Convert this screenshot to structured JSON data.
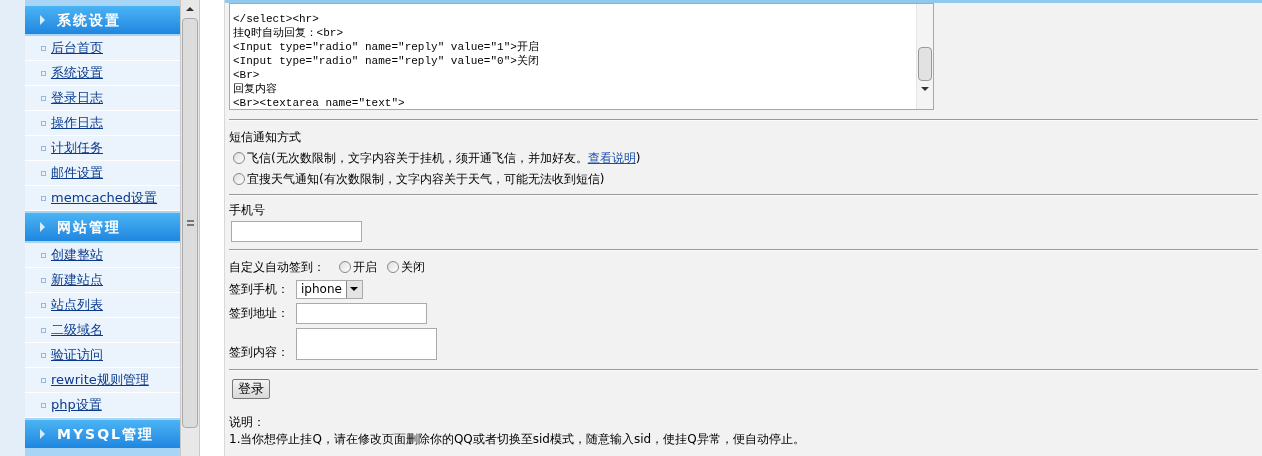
{
  "sidebar": {
    "sections": [
      {
        "title": "系统设置",
        "items": [
          "后台首页",
          "系统设置",
          "登录日志",
          "操作日志",
          "计划任务",
          "邮件设置",
          "memcached设置"
        ]
      },
      {
        "title": "网站管理",
        "items": [
          "创建整站",
          "新建站点",
          "站点列表",
          "二级域名",
          "验证访问",
          "rewrite规则管理",
          "php设置"
        ]
      },
      {
        "title": "MYSQL管理"
      }
    ]
  },
  "code_editor": {
    "lines": [
      "</select><hr>",
      "挂Q时自动回复：<br>",
      "<Input type=\"radio\" name=\"reply\" value=\"1\">开启",
      "<Input type=\"radio\" name=\"reply\" value=\"0\">关闭",
      "<Br>",
      "回复内容",
      "<Br><textarea name=\"text\">"
    ]
  },
  "sms": {
    "label": "短信通知方式",
    "options": [
      {
        "text": "飞信(无次数限制，文字内容关于挂机，须开通飞信，并加好友。",
        "link": "查看说明",
        "suffix": ")",
        "checked": false
      },
      {
        "text": "宜搜天气通知(有次数限制，文字内容关于天气，可能无法收到短信)",
        "checked": false
      }
    ]
  },
  "phone": {
    "label": "手机号"
  },
  "checkin": {
    "label": "自定义自动签到：",
    "options": [
      {
        "text": "开启",
        "checked": false
      },
      {
        "text": "关闭",
        "checked": false
      }
    ],
    "phone_label": "签到手机：",
    "phone_value": "iphone",
    "address_label": "签到地址：",
    "content_label": "签到内容："
  },
  "login_button": "登录",
  "notes": {
    "title": "说明：",
    "lines": [
      "1.当你想停止挂Q，请在修改页面删除你的QQ或者切换至sid模式，随意输入sid，使挂Q异常，便自动停止。"
    ]
  }
}
